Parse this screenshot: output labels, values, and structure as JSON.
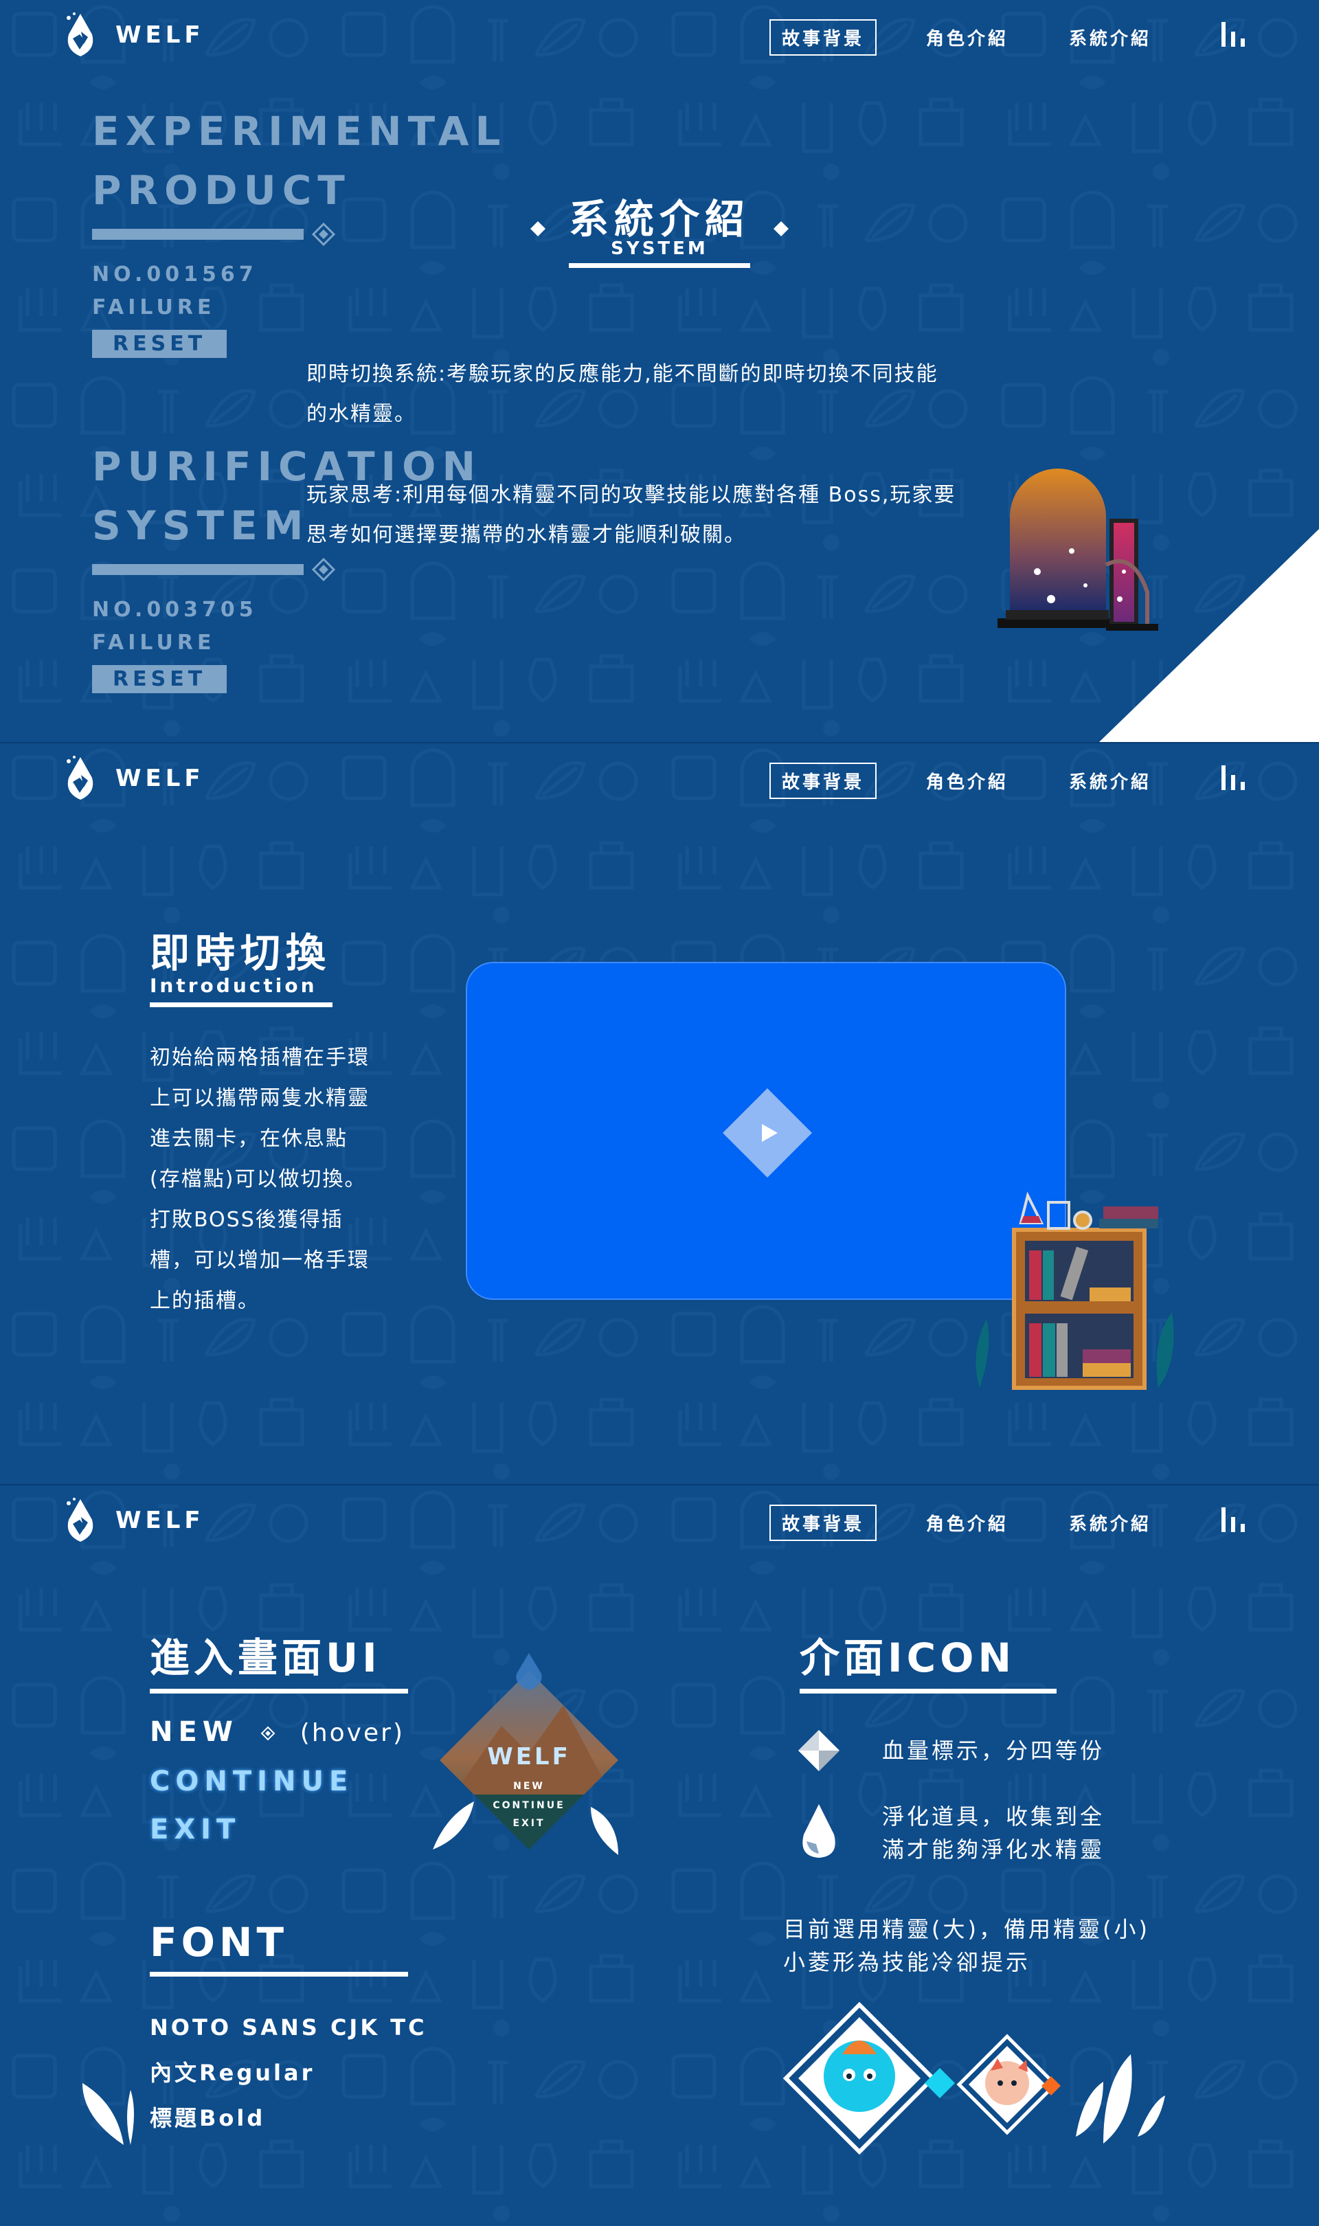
{
  "brand": {
    "name": "WELF"
  },
  "nav": {
    "items": [
      "故事背景",
      "角色介紹",
      "系統介紹"
    ],
    "active_index": 0
  },
  "section1": {
    "title": "系統介紹",
    "subtitle": "SYSTEM",
    "paragraph1_line1": "即時切換系統:考驗玩家的反應能力,能不間斷的即時切換不同技能",
    "paragraph1_line2": "的水精靈。",
    "paragraph2_line1": "玩家思考:利用每個水精靈不同的攻擊技能以應對各種 Boss,玩家要",
    "paragraph2_line2": "思考如何選擇要攜帶的水精靈才能順利破關。",
    "experiment1": {
      "title_line1": "EXPERIMENTAL",
      "title_line2": "PRODUCT",
      "number": "NO.001567",
      "status": "FAILURE",
      "button": "RESET"
    },
    "experiment2": {
      "title_line1": "PURIFICATION",
      "title_line2": "SYSTEM",
      "number": "NO.003705",
      "status": "FAILURE",
      "button": "RESET"
    }
  },
  "section2": {
    "title": "即時切換",
    "subtitle": "Introduction",
    "lines": [
      "初始給兩格插槽在手環",
      "上可以攜帶兩隻水精靈",
      "進去關卡，在休息點",
      "(存檔點)可以做切換。",
      "打敗BOSS後獲得插",
      "槽，可以增加一格手環",
      "上的插槽。"
    ]
  },
  "section3": {
    "ui_title": "進入畫面UI",
    "menu": {
      "new": "NEW",
      "hover_hint": "(hover)",
      "continue": "CONTINUE",
      "exit": "EXIT"
    },
    "preview_menu": {
      "logo": "WELF",
      "new": "NEW",
      "continue": "CONTINUE",
      "exit": "EXIT"
    },
    "font_title": "FONT",
    "font_lines": [
      "NOTO SANS CJK TC",
      "內文Regular",
      "標題Bold"
    ],
    "icon_title": "介面ICON",
    "icon_items": [
      {
        "text": "血量標示，分四等份",
        "icon": "hp-diamond-icon"
      },
      {
        "text_line1": "淨化道具，收集到全",
        "text_line2": "滿才能夠淨化水精靈",
        "icon": "water-drop-icon"
      }
    ],
    "spirit_note_line1": "目前選用精靈(大)，備用精靈(小)",
    "spirit_note_line2": "小菱形為技能冷卻提示"
  },
  "colors": {
    "background": "#0e4c8a",
    "muted": "#7ea4c8",
    "video": "#0064f5",
    "accent_cyan": "#19d3f0",
    "accent_orange": "#f56a1e"
  }
}
